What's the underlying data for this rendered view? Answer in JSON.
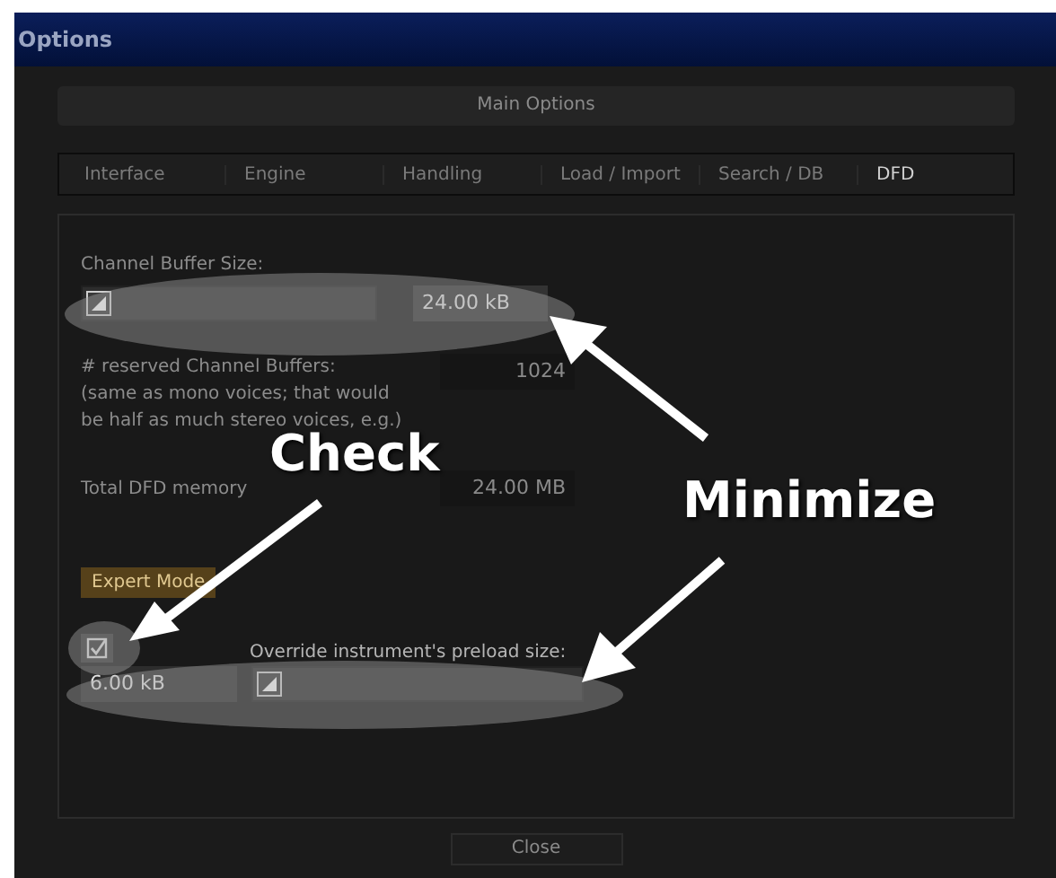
{
  "window": {
    "title": "Options"
  },
  "header": "Main Options",
  "tabs": [
    {
      "label": "Interface",
      "selected": false
    },
    {
      "label": "Engine",
      "selected": false
    },
    {
      "label": "Handling",
      "selected": false
    },
    {
      "label": "Load / Import",
      "selected": false
    },
    {
      "label": "Search / DB",
      "selected": false
    },
    {
      "label": "DFD",
      "selected": true
    }
  ],
  "dfd": {
    "buffer_size": {
      "label": "Channel Buffer Size:",
      "level": 0,
      "value": "24.00 kB"
    },
    "reserved_buffers": {
      "label": "# reserved Channel Buffers:\n(same as mono voices; that would\nbe half as much stereo voices, e.g.)",
      "value": "1024"
    },
    "total_memory": {
      "label": "Total DFD memory",
      "value": "24.00 MB"
    },
    "expert_mode_button": "Expert Mode",
    "override": {
      "checked": true,
      "label": "Override instrument's preload size:",
      "value": "6.00 kB",
      "level": 0
    }
  },
  "close_button": "Close",
  "annotations": [
    "Check",
    "Minimize"
  ]
}
